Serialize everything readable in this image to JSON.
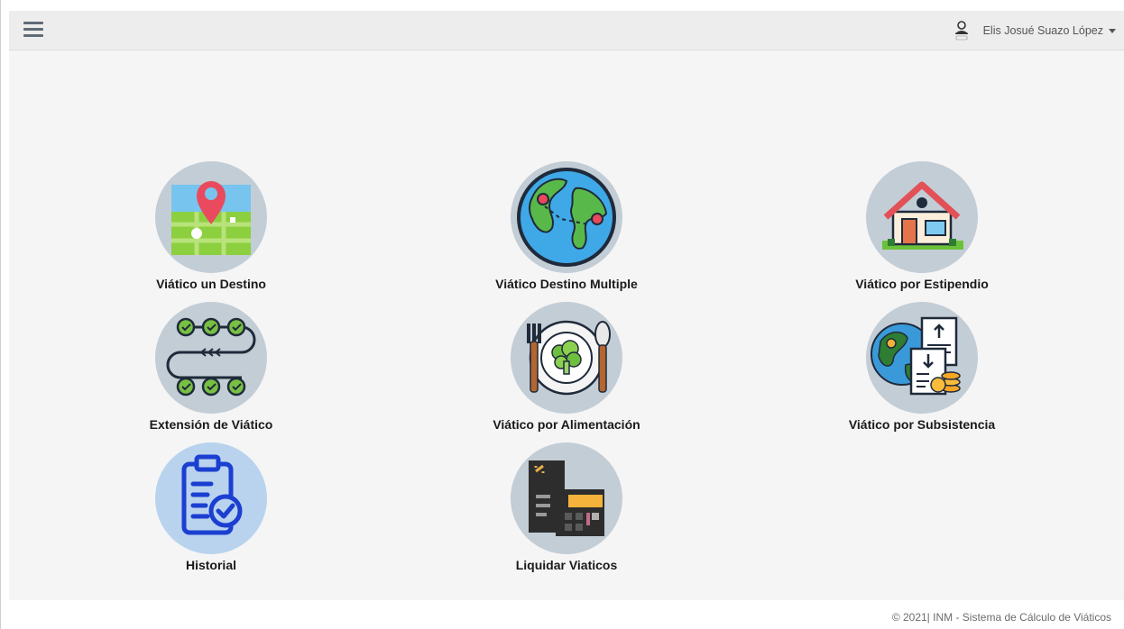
{
  "header": {
    "user_name": "Elis Josué Suazo López"
  },
  "tiles": [
    {
      "label": "Viático un Destino",
      "icon": "map-pin-icon"
    },
    {
      "label": "Viático Destino Multiple",
      "icon": "globe-icon"
    },
    {
      "label": "Viático por Estipendio",
      "icon": "house-icon"
    },
    {
      "label": "Extensión de Viático",
      "icon": "checklist-flow-icon"
    },
    {
      "label": "Viático por Alimentación",
      "icon": "plate-food-icon"
    },
    {
      "label": "Viático por Subsistencia",
      "icon": "documents-globe-icon"
    },
    {
      "label": "Historial",
      "icon": "clipboard-check-icon"
    },
    {
      "label": "Liquidar Viaticos",
      "icon": "calculator-document-icon"
    }
  ],
  "footer": {
    "text": "© 2021| INM - Sistema de Cálculo de Viáticos"
  },
  "colors": {
    "navbar": "#ededed",
    "background": "#f5f5f5",
    "circle": "#c3cdd6",
    "circle_blue": "#b9d3ee"
  }
}
